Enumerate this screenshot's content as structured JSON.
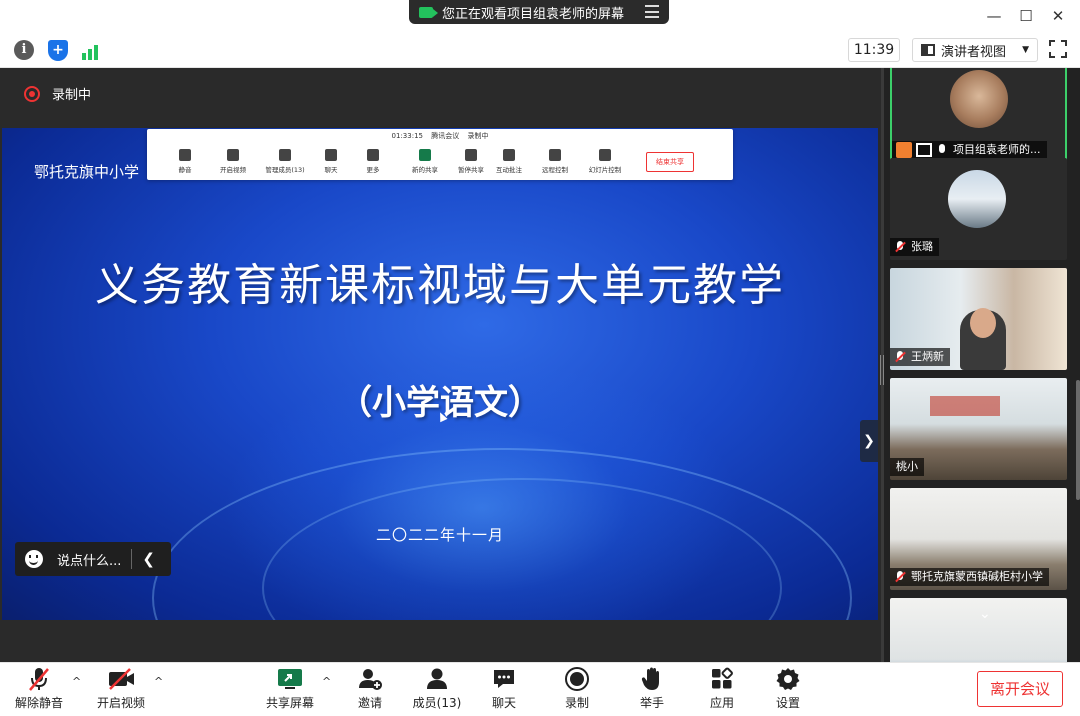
{
  "window": {
    "viewing_banner": "您正在观看项目组袁老师的屏幕",
    "minimize_glyph": "—",
    "maximize_glyph": "☐",
    "close_glyph": "✕"
  },
  "infobar": {
    "info_glyph": "i",
    "shield_glyph": "+",
    "clock": "11:39",
    "view_mode": "演讲者视图",
    "view_caret": "▼"
  },
  "stage": {
    "recording_label": "录制中"
  },
  "slide": {
    "school": "鄂托克旗中小学",
    "title": "义务教育新课标视域与大单元教学",
    "subtitle": "（小学语文）",
    "date": "二〇二二年十一月"
  },
  "sharebar": {
    "timer": "01:33:15",
    "app_name": "腾讯会议",
    "rec_label": "录制中",
    "items": [
      {
        "label": "静音"
      },
      {
        "label": "开启视频"
      },
      {
        "label": "管理成员(13)"
      },
      {
        "label": "聊天"
      },
      {
        "label": "更多"
      },
      {
        "label": "新的共享"
      },
      {
        "label": "暂停共享"
      },
      {
        "label": "互动批注"
      },
      {
        "label": "远程控制"
      },
      {
        "label": "幻灯片控制"
      }
    ],
    "end_label": "结束共享"
  },
  "chat": {
    "placeholder": "说点什么...",
    "chevron": "❮"
  },
  "collapse_glyph": "❯",
  "videos": [
    {
      "name": "项目组袁老师的..."
    },
    {
      "name": "张璐"
    },
    {
      "name": "王炳新"
    },
    {
      "name": "桃小"
    },
    {
      "name": "鄂托克旗蒙西镇碱柜村小学"
    },
    {
      "name": ""
    }
  ],
  "video_more_glyph": "⌄",
  "bottombar": {
    "unmute": "解除静音",
    "video": "开启视频",
    "share": "共享屏幕",
    "invite": "邀请",
    "members": "成员(13)",
    "chat": "聊天",
    "record": "录制",
    "raise_hand": "举手",
    "apps": "应用",
    "settings": "设置",
    "leave": "离开会议",
    "caret": "^"
  },
  "colors": {
    "accent_green": "#23c25d",
    "record_red": "#e33333",
    "slide_blue": "#1948c8",
    "active_tile": "#3ccf6a"
  }
}
